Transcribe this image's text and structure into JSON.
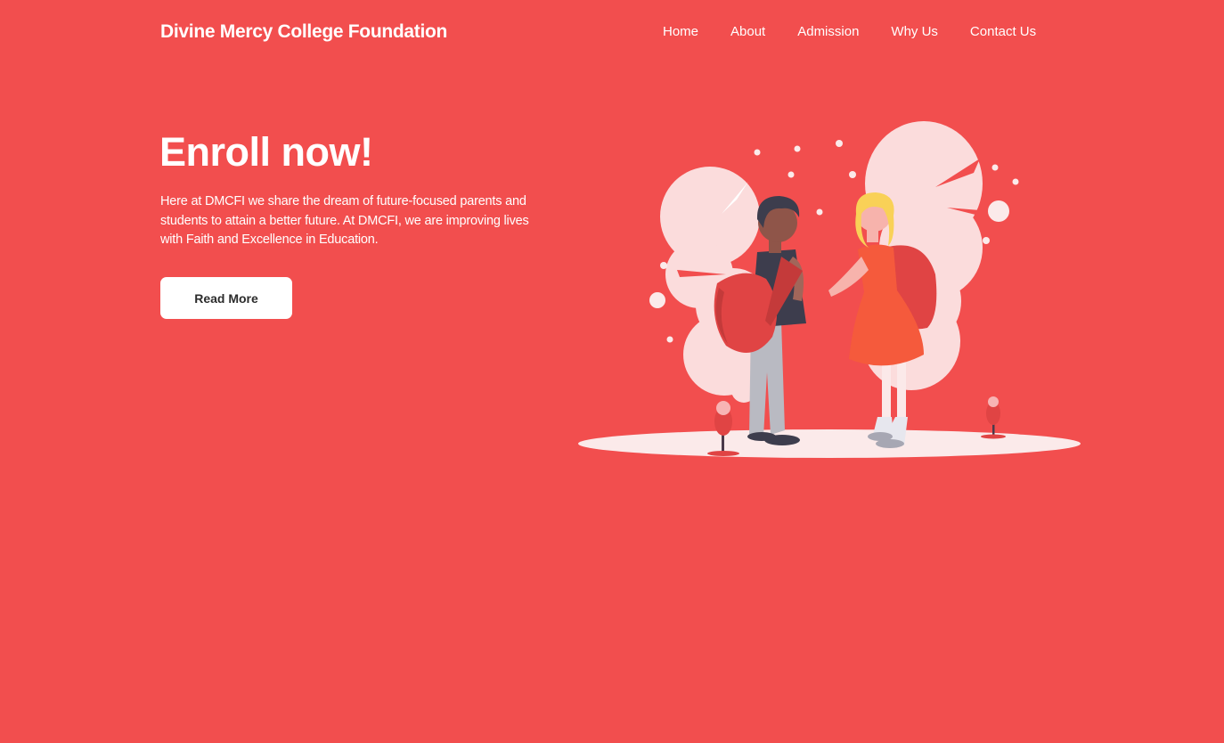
{
  "header": {
    "brand": "Divine Mercy College Foundation",
    "nav": [
      {
        "label": "Home"
      },
      {
        "label": "About"
      },
      {
        "label": "Admission"
      },
      {
        "label": "Why Us"
      },
      {
        "label": "Contact Us"
      }
    ]
  },
  "hero": {
    "title": "Enroll now!",
    "description": "Here at DMCFI we share the dream of future-focused parents and students to attain a better future. At DMCFI, we are improving lives with Faith and Excellence in Education.",
    "cta_label": "Read More",
    "illustration": "students-with-backpacks-illustration"
  },
  "theme": {
    "background": "#f24e4e",
    "text": "#ffffff",
    "button_bg": "#ffffff",
    "button_text": "#2c2c2c"
  }
}
